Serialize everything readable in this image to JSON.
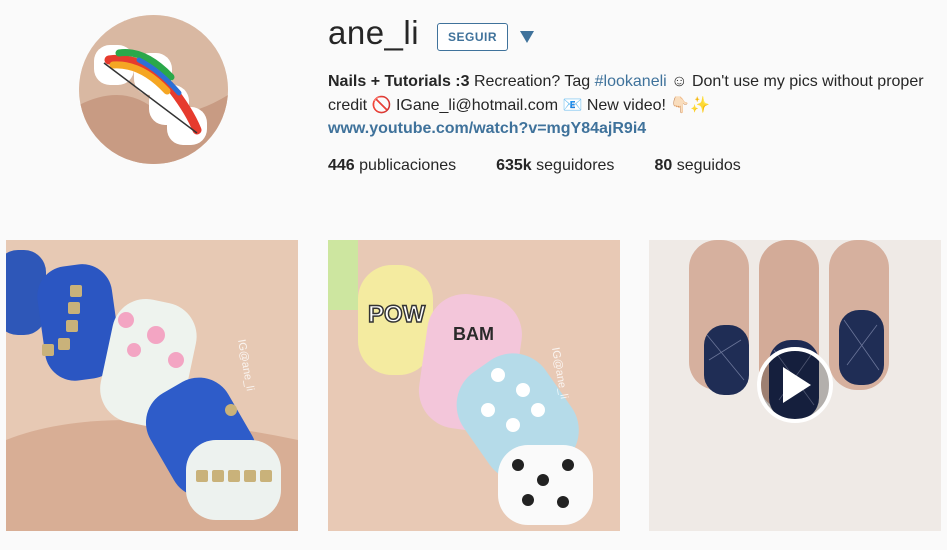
{
  "profile": {
    "username": "ane_li",
    "follow_label": "SEGUIR",
    "bio_bold": "Nails + Tutorials :3",
    "bio_mid": " Recreation? Tag ",
    "bio_hashtag": "#lookaneli",
    "bio_rest": " ☺ Don't use my pics without proper credit 🚫 IGane_li@hotmail.com 📧 New video! 👇🏻✨",
    "link": "www.youtube.com/watch?v=mgY84ajR9i4"
  },
  "stats": [
    {
      "value": "446",
      "label": "publicaciones"
    },
    {
      "value": "635k",
      "label": "seguidores"
    },
    {
      "value": "80",
      "label": "seguidos"
    }
  ],
  "posts": [
    {
      "alt": "denim and floral nails with studs",
      "watermark": "IG@ane_li"
    },
    {
      "alt": "pop art comic nails",
      "watermark": "IG@ane_li",
      "pow": "POW",
      "bam": "BAM"
    },
    {
      "alt": "navy stamped nails video",
      "video": true
    }
  ],
  "colors": {
    "accent": "#3f729b",
    "text": "#262626",
    "background": "#fafafa"
  }
}
